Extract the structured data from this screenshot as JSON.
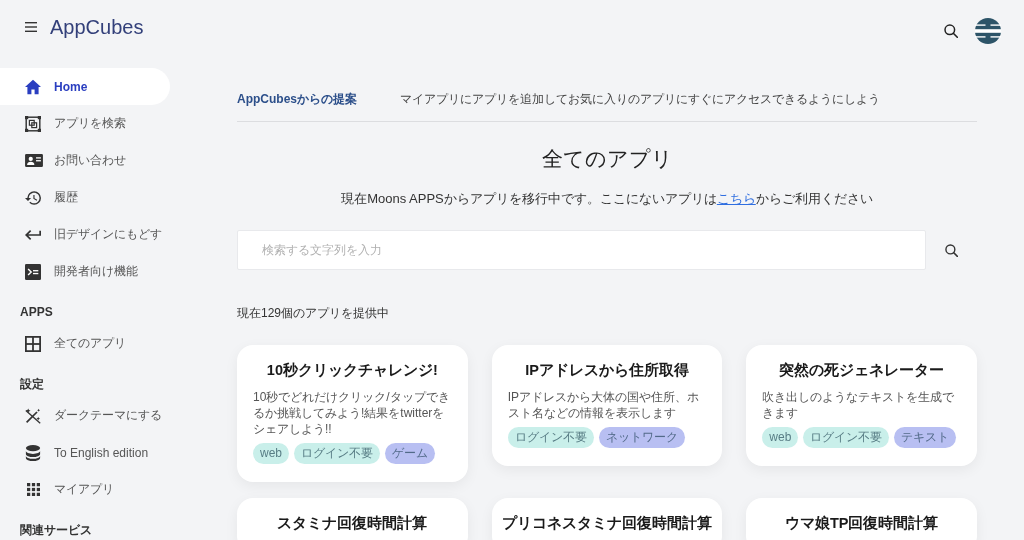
{
  "header": {
    "title": "AppCubes"
  },
  "sidebar": {
    "items": [
      {
        "label": "Home",
        "selected": true
      },
      {
        "label": "アプリを検索",
        "selected": false
      },
      {
        "label": "お問い合わせ",
        "selected": false
      },
      {
        "label": "履歴",
        "selected": false
      },
      {
        "label": "旧デザインにもどす",
        "selected": false
      },
      {
        "label": "開発者向け機能",
        "selected": false
      }
    ],
    "sections": [
      {
        "heading": "APPS",
        "items": [
          {
            "label": "全てのアプリ",
            "selected": false
          }
        ]
      },
      {
        "heading": "設定",
        "items": [
          {
            "label": "ダークテーマにする",
            "selected": false
          },
          {
            "label": "To English edition",
            "selected": false
          },
          {
            "label": "マイアプリ",
            "selected": false
          }
        ]
      },
      {
        "heading": "関連サービス"
      }
    ]
  },
  "suggestion": {
    "label": "AppCubesからの提案",
    "message": "マイアプリにアプリを追加してお気に入りのアプリにすぐにアクセスできるようにしよう"
  },
  "page_title": "全てのアプリ",
  "notice": {
    "before": "現在Moons APPSからアプリを移行中です。ここにないアプリは",
    "link": "こちら",
    "after": "からご利用ください"
  },
  "search": {
    "placeholder": "検索する文字列を入力"
  },
  "app_count": "現在129個のアプリを提供中",
  "apps": [
    {
      "title": "10秒クリックチャレンジ!",
      "description": "10秒でどれだけクリック/タップできるか挑戦してみよう!結果をtwitterをシェアしよう!!",
      "tags": [
        {
          "label": "web",
          "color": "#c9efea"
        },
        {
          "label": "ログイン不要",
          "color": "#c9efea"
        },
        {
          "label": "ゲーム",
          "color": "#b8bff2"
        }
      ]
    },
    {
      "title": "IPアドレスから住所取得",
      "description": "IPアドレスから大体の国や住所、ホスト名などの情報を表示します",
      "tags": [
        {
          "label": "ログイン不要",
          "color": "#c9efea"
        },
        {
          "label": "ネットワーク",
          "color": "#b8bff2"
        }
      ]
    },
    {
      "title": "突然の死ジェネレーター",
      "description": "吹き出しのようなテキストを生成できます",
      "tags": [
        {
          "label": "web",
          "color": "#c9efea"
        },
        {
          "label": "ログイン不要",
          "color": "#c9efea"
        },
        {
          "label": "テキスト",
          "color": "#b8bff2"
        }
      ]
    },
    {
      "title": "スタミナ回復時間計算"
    },
    {
      "title": "プリコネスタミナ回復時間計算"
    },
    {
      "title": "ウマ娘TP回復時間計算"
    }
  ]
}
